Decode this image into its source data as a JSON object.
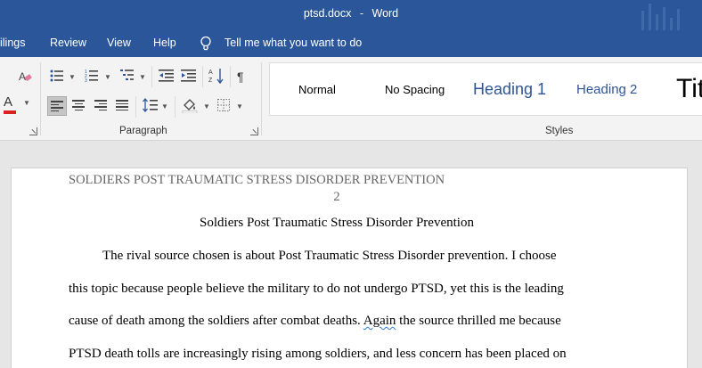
{
  "window": {
    "filename": "ptsd.docx",
    "separator": "-",
    "app": "Word"
  },
  "menu": {
    "items": [
      "ilings",
      "Review",
      "View",
      "Help"
    ],
    "tell_me": "Tell me what you want to do"
  },
  "ribbon": {
    "paragraph_label": "Paragraph",
    "styles_label": "Styles",
    "styles": [
      "Normal",
      "No Spacing",
      "Heading 1",
      "Heading 2",
      "Tit"
    ],
    "colors": {
      "font_color_bar": "#d92121",
      "heading": "#2f5496"
    }
  },
  "document": {
    "header": "SOLDIERS POST TRAUMATIC STRESS DISORDER PREVENTION",
    "page_number": "2",
    "title": "Soldiers Post Traumatic Stress Disorder Prevention",
    "line1": "The rival source chosen is about Post Traumatic Stress Disorder prevention. I choose",
    "line2": "this topic because people believe the military to do not undergo PTSD, yet this is the leading",
    "line3_a": "cause of death among the soldiers after combat deaths.",
    "line3_b": "Again",
    "line3_c": "the source thrilled me because",
    "line4": "PTSD death tolls are increasingly rising among soldiers, and less concern has been placed on"
  }
}
